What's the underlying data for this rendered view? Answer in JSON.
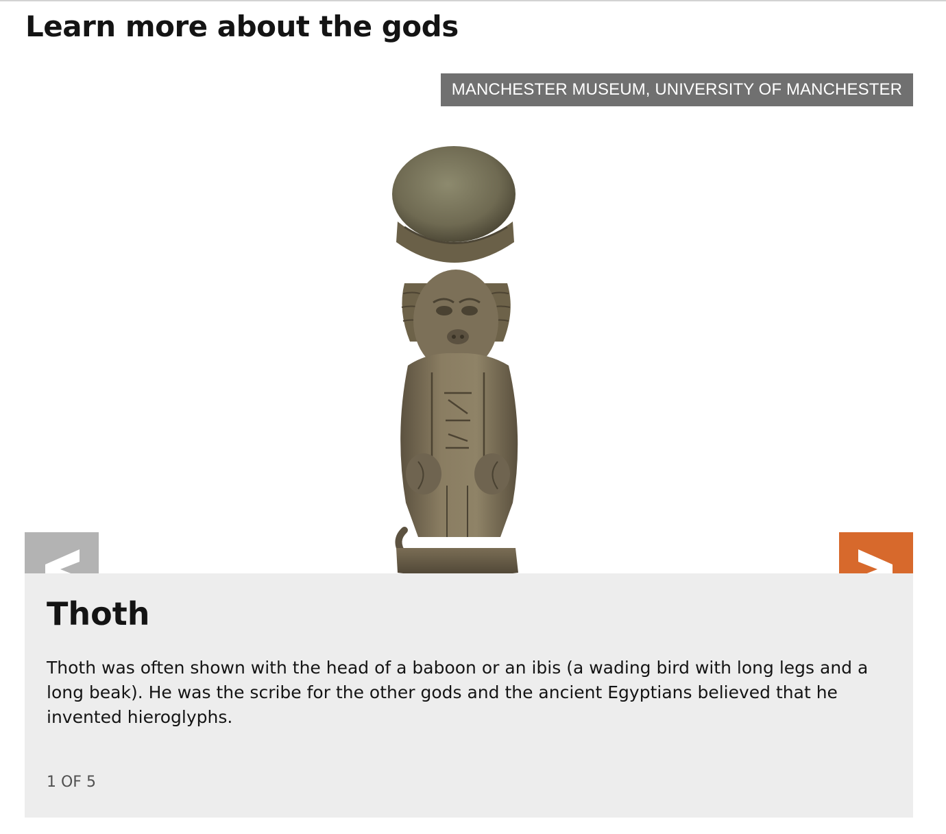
{
  "section": {
    "title": "Learn more about the gods"
  },
  "gallery": {
    "credit": "MANCHESTER MUSEUM, UNIVERSITY OF MANCHESTER",
    "prev_icon": "chevron-left-icon",
    "next_icon": "chevron-right-icon",
    "slide": {
      "title": "Thoth",
      "description": "Thoth was often shown with the head of a baboon or an ibis (a wading bird with long legs and a long beak). He was the scribe for the other gods and the ancient Egyptians believed that he invented hieroglyphs.",
      "counter": "1 OF 5"
    },
    "current_index": 1,
    "total": 5
  },
  "colors": {
    "next_button": "#d7692c",
    "prev_button": "#b3b3b3",
    "credit_badge": "#707070",
    "caption_background": "#ededed"
  }
}
